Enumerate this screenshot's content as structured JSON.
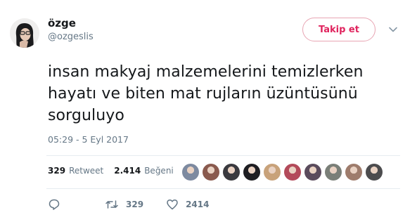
{
  "user": {
    "display_name": "özge",
    "handle": "@ozgeslis"
  },
  "follow_button": {
    "label": "Takip et"
  },
  "tweet": {
    "lines": [
      "insan makyaj malzemelerini temizlerken",
      "hayatı ve biten mat rujların üzüntüsünü",
      "sorguluyo"
    ],
    "timestamp": "05:29 - 5 Eyl 2017"
  },
  "stats": {
    "retweet_count": "329",
    "retweet_label": "Retweet",
    "like_count": "2.414",
    "like_label": "Beğeni"
  },
  "actions": {
    "retweet_count": "329",
    "like_count": "2414"
  },
  "liker_avatars": [
    "#7d8aa0",
    "#8a5a4e",
    "#3a3a3f",
    "#1e1e22",
    "#c8a27a",
    "#b34a5a",
    "#5a4b5c",
    "#7a7f78",
    "#9e7c6c",
    "#4c4c4e"
  ],
  "colors": {
    "follow_accent": "#e0245e",
    "text": "#14171a",
    "secondary": "#657786"
  }
}
